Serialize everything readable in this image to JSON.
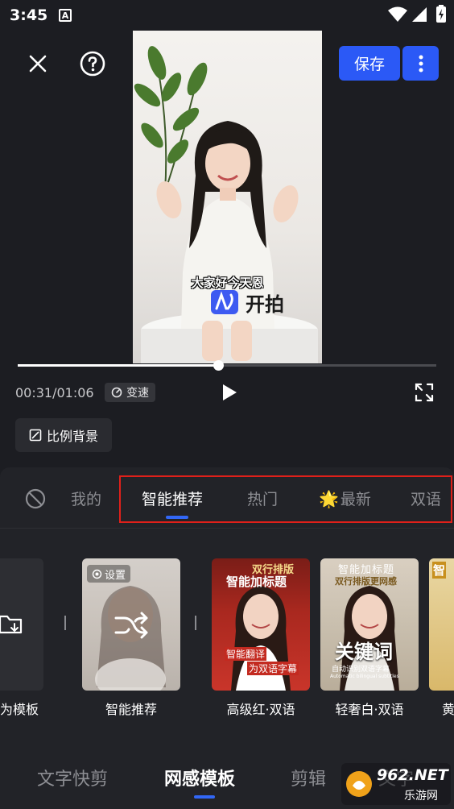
{
  "status_bar": {
    "time": "3:45"
  },
  "toolbar": {
    "save_label": "保存"
  },
  "video": {
    "subtitle": "大家好今天恩",
    "logo_text": "开拍",
    "progress": 0.479
  },
  "playback": {
    "time": "00:31/01:06",
    "speed_label": "变速"
  },
  "ratio_button": {
    "label": "比例背景"
  },
  "tabs": [
    {
      "label": "我的"
    },
    {
      "label": "智能推荐"
    },
    {
      "label": "热门"
    },
    {
      "label": "最新"
    },
    {
      "label": "双语"
    }
  ],
  "cards": [
    {
      "label": "为模板"
    },
    {
      "label": "智能推荐",
      "badge": "设置"
    },
    {
      "label": "高级红·双语",
      "title1": "双行排版",
      "title2": "智能加标题",
      "tag1": "智能翻译",
      "tag2": "为双语字幕"
    },
    {
      "label": "轻奢白·双语",
      "title1": "智能加标题",
      "title2": "双行排版更网感",
      "keyword": "关键词",
      "caption": "自动识别双语字幕",
      "caption_en": "Automatic bilingual subtitles"
    },
    {
      "label": "黄",
      "title1": "智"
    }
  ],
  "bottom_nav": [
    {
      "label": "文字快剪"
    },
    {
      "label": "网感模板"
    },
    {
      "label": "剪辑"
    },
    {
      "label": "文字"
    }
  ],
  "watermark": {
    "brand": "962.NET",
    "sub": "乐游网"
  },
  "colors": {
    "accent": "#2b59f6",
    "indicator": "#3267f6",
    "highlight": "#e0201a"
  }
}
